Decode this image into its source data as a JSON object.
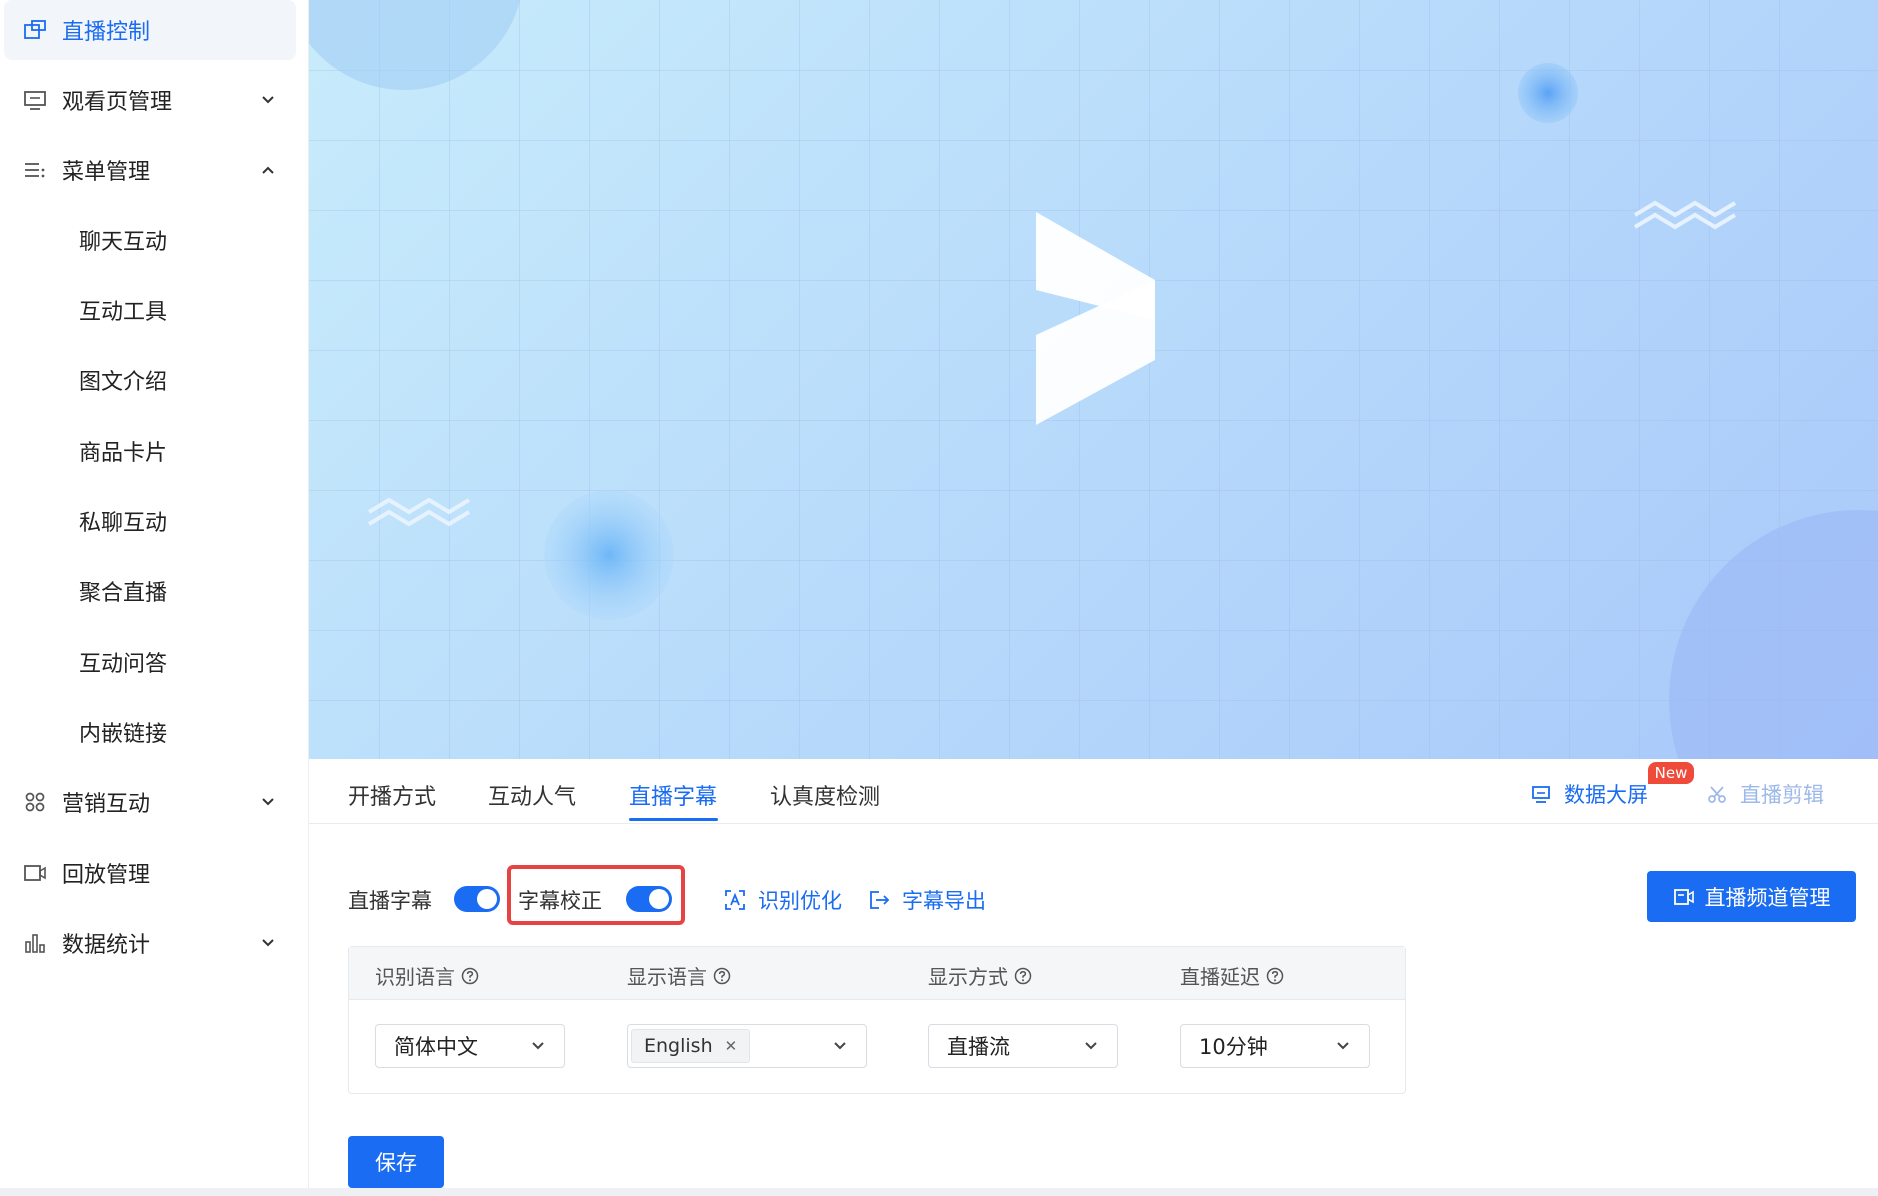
{
  "sidebar": {
    "items": [
      {
        "label": "直播控制",
        "icon": "monitor-icon",
        "active": true
      },
      {
        "label": "观看页管理",
        "icon": "screen-icon"
      },
      {
        "label": "菜单管理",
        "icon": "list-icon"
      },
      {
        "label": "营销互动",
        "icon": "grid-icon"
      },
      {
        "label": "回放管理",
        "icon": "video-icon"
      },
      {
        "label": "数据统计",
        "icon": "bar-chart-icon"
      }
    ],
    "submenu": [
      "聊天互动",
      "互动工具",
      "图文介绍",
      "商品卡片",
      "私聊互动",
      "聚合直播",
      "互动问答",
      "内嵌链接"
    ]
  },
  "tabs": [
    "开播方式",
    "互动人气",
    "直播字幕",
    "认真度检测"
  ],
  "active_tab": "直播字幕",
  "links": {
    "data_screen": "数据大屏",
    "new_badge": "New",
    "live_clip": "直播剪辑",
    "recognize_optimize": "识别优化",
    "subtitle_export": "字幕导出"
  },
  "toggles": {
    "live_subtitle": "直播字幕",
    "subtitle_correction": "字幕校正"
  },
  "channel_button": "直播频道管理",
  "settings": {
    "columns": [
      "识别语言",
      "显示语言",
      "显示方式",
      "直播延迟"
    ],
    "recognize_language": "简体中文",
    "display_language_tag": "English",
    "display_mode": "直播流",
    "delay": "10分钟"
  },
  "save_button": "保存",
  "colors": {
    "accent": "#1a6cf2",
    "highlight": "#e84343",
    "badge": "#ee4b3b"
  }
}
